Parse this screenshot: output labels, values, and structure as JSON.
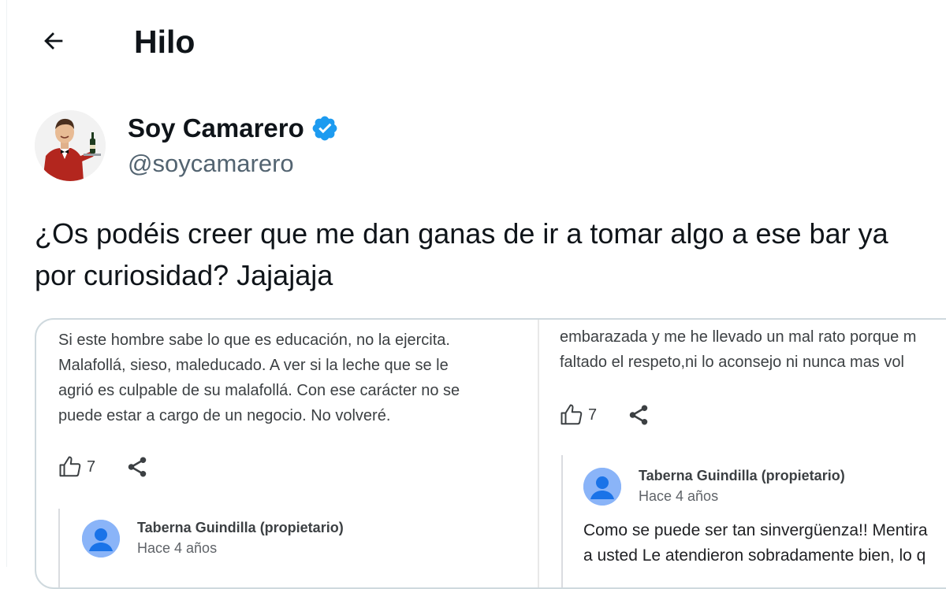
{
  "header": {
    "title": "Hilo"
  },
  "author": {
    "name": "Soy Camarero",
    "handle": "@soycamarero"
  },
  "tweet": {
    "text_line1": "¿Os podéis creer que me dan ganas de ir a tomar algo a ese bar ya",
    "text_line2": "por curiosidad? Jajajaja"
  },
  "media": {
    "left_review": {
      "lines": [
        "Si este hombre sabe lo que es educación, no la ejercita.",
        "Malafollá, sieso, maleducado. A ver si la leche que se le",
        "agrió es culpable de su malafollá. Con ese carácter no se",
        "puede estar a cargo de un negocio. No volveré."
      ],
      "likes": "7",
      "reply": {
        "owner": "Taberna Guindilla (propietario)",
        "time": "Hace 4 años"
      }
    },
    "right_review": {
      "lines": [
        "embarazada y me he llevado un mal rato porque m",
        "faltado el respeto,ni lo aconsejo ni nunca mas vol"
      ],
      "likes": "7",
      "reply": {
        "owner": "Taberna Guindilla (propietario)",
        "time": "Hace 4 años",
        "text_line1": "Como se puede ser tan sinvergüenza!! Mentira",
        "text_line2": "a usted Le atendieron sobradamente bien, lo q"
      }
    }
  },
  "colors": {
    "verified": "#1d9bf0",
    "text": "#0f1419",
    "secondary": "#536471",
    "card_border": "#cfd9de"
  }
}
